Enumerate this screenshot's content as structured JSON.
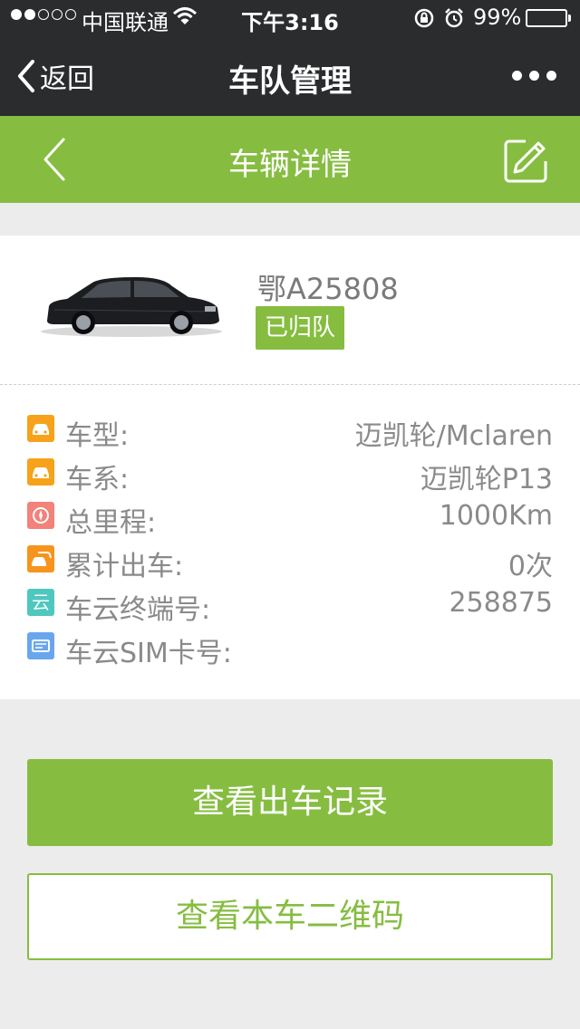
{
  "status_bar": {
    "carrier": "中国联通",
    "time": "下午3:16",
    "battery": "99%"
  },
  "navbar": {
    "back_label": "返回",
    "title": "车队管理"
  },
  "subheader": {
    "title": "车辆详情"
  },
  "vehicle": {
    "plate": "鄂A25808",
    "status_badge": "已归队"
  },
  "info": [
    {
      "label": "车型:",
      "value": "迈凯轮/Mclaren",
      "icon": "car-model-icon",
      "color": "#f7a21b"
    },
    {
      "label": "车系:",
      "value": "迈凯轮P13",
      "icon": "car-series-icon",
      "color": "#f7a21b"
    },
    {
      "label": "总里程:",
      "value": "1000Km",
      "icon": "compass-icon",
      "color": "#f2827a"
    },
    {
      "label": "累计出车:",
      "value": "0次",
      "icon": "dispatch-icon",
      "color": "#f7941d"
    },
    {
      "label": "车云终端号:",
      "value": "258875",
      "icon": "cloud-terminal-icon",
      "color": "#4ec7bf",
      "glyph": "云"
    },
    {
      "label": "车云SIM卡号:",
      "value": "",
      "icon": "sim-card-icon",
      "color": "#6aa6ee"
    }
  ],
  "actions": {
    "primary": "查看出车记录",
    "secondary": "查看本车二维码"
  },
  "colors": {
    "accent": "#86bd41",
    "dark_bar": "#2a2c2e",
    "background": "#ececec"
  }
}
